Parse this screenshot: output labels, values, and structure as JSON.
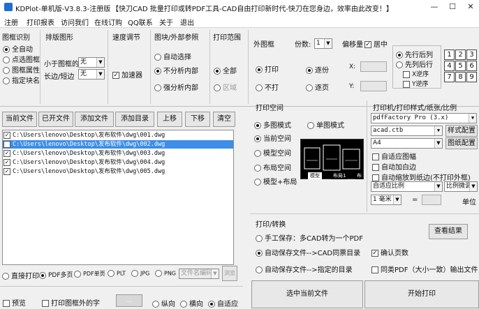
{
  "window": {
    "title": "KDPlot-单机版-V3.8.3-注册版",
    "banner": "【快刀CAD 批量打印或转PDF工具-CAD自由打印新时代-快刀在您身边，效率由此改变！】",
    "minimize": "—",
    "maximize": "☐",
    "close": "✕"
  },
  "menu": [
    "注册",
    "打印报表",
    "访问我们",
    "在线订购",
    "QQ联系",
    "关于",
    "退出"
  ],
  "frame_id": {
    "title": "图框识别",
    "options": [
      "全自动",
      "点选图框",
      "图框属性",
      "指定块名"
    ],
    "selected": 0
  },
  "sort": {
    "title": "排版图形",
    "label1": "小于图框的",
    "label2": "长边/短边",
    "val1": "无",
    "val2": "无"
  },
  "speed": {
    "title": "速度调节",
    "accel": "加速器",
    "accel_checked": true
  },
  "blocks": {
    "title": "图块/外部参照",
    "options": [
      "自动选择",
      "不分析内部",
      "强分析内部"
    ],
    "selected": 1
  },
  "range": {
    "title": "打印范围",
    "options": [
      "全部",
      "区域"
    ],
    "selected": 0
  },
  "outer": {
    "title": "外图框",
    "options": [
      "打印",
      "不打"
    ],
    "selected": 0
  },
  "copies": {
    "title": "份数:",
    "value": "1",
    "options": [
      "逐份",
      "逐页"
    ],
    "selected": 0
  },
  "offset": {
    "title": "偏移量",
    "center": "居中",
    "center_checked": true,
    "x_label": "X:",
    "y_label": "Y:"
  },
  "order": {
    "options": [
      "先行后列",
      "先列后行"
    ],
    "selected": 0,
    "x_rev": "X逆序",
    "y_rev": "Y逆序"
  },
  "grid_numbers": [
    "1",
    "2",
    "3",
    "4",
    "5",
    "6",
    "7",
    "8",
    "9"
  ],
  "file_buttons": [
    "当前文件",
    "已开文件",
    "添加文件",
    "添加目录",
    "上移",
    "下移",
    "清空"
  ],
  "files": [
    {
      "path": "C:\\Users\\lenovo\\Desktop\\发布软件\\dwg\\001.dwg",
      "checked": true
    },
    {
      "path": "C:\\Users\\lenovo\\Desktop\\发布软件\\dwg\\002.dwg",
      "checked": false
    },
    {
      "path": "C:\\Users\\lenovo\\Desktop\\发布软件\\dwg\\003.dwg",
      "checked": true
    },
    {
      "path": "C:\\Users\\lenovo\\Desktop\\发布软件\\dwg\\004.dwg",
      "checked": true
    },
    {
      "path": "C:\\Users\\lenovo\\Desktop\\发布软件\\dwg\\005.dwg",
      "checked": true
    }
  ],
  "selected_file_index": 1,
  "outputs": {
    "options": [
      "直接打印",
      "PDF多页",
      "PDF单页",
      "PLT",
      "JPG",
      "PNG"
    ],
    "selected": 1,
    "filename_placeholder": "文件名编码",
    "more": "浏览"
  },
  "bottom": {
    "preview": "预览",
    "print_outside": "打印图框外的字",
    "dots": "...",
    "orient": [
      "纵向",
      "横向",
      "自适应"
    ],
    "orient_selected": 2
  },
  "space": {
    "title": "打印空间",
    "options": [
      "多图模式",
      "单图模式",
      "当前空间",
      "模型空间",
      "布局空间",
      "模型+布局"
    ],
    "selected_left": 0,
    "selected_right": null,
    "preview_tabs": [
      "模型",
      "布局1",
      "布"
    ]
  },
  "plotter": {
    "title": "打印机/打印样式/纸张/比例",
    "printer": "pdfFactory Pro (3.x)",
    "style": "acad.ctb",
    "paper": "A4",
    "style_btn": "样式配置",
    "paper_btn": "图纸配置",
    "checks": [
      "自适应图幅",
      "自动加白边",
      "自动缩放到纸边(不打印外框)"
    ],
    "scale": "自适应比例",
    "scale_fine": "比例微调",
    "unit_val": "1 毫米",
    "eq": "=",
    "unit": "单位"
  },
  "convert": {
    "title": "打印/转换",
    "options": [
      "手工保存：多CAD转为一个PDF",
      "自动保存文件-->CAD同票目录",
      "自动保存文件-->指定的目录"
    ],
    "selected": 1,
    "view_btn": "查看结果",
    "confirm": "确认页数",
    "confirm_checked": true,
    "same": "同类PDF（大小一致）输出文件",
    "same_checked": false
  },
  "actions": {
    "select_current": "选中当前文件",
    "start": "开始打印"
  }
}
